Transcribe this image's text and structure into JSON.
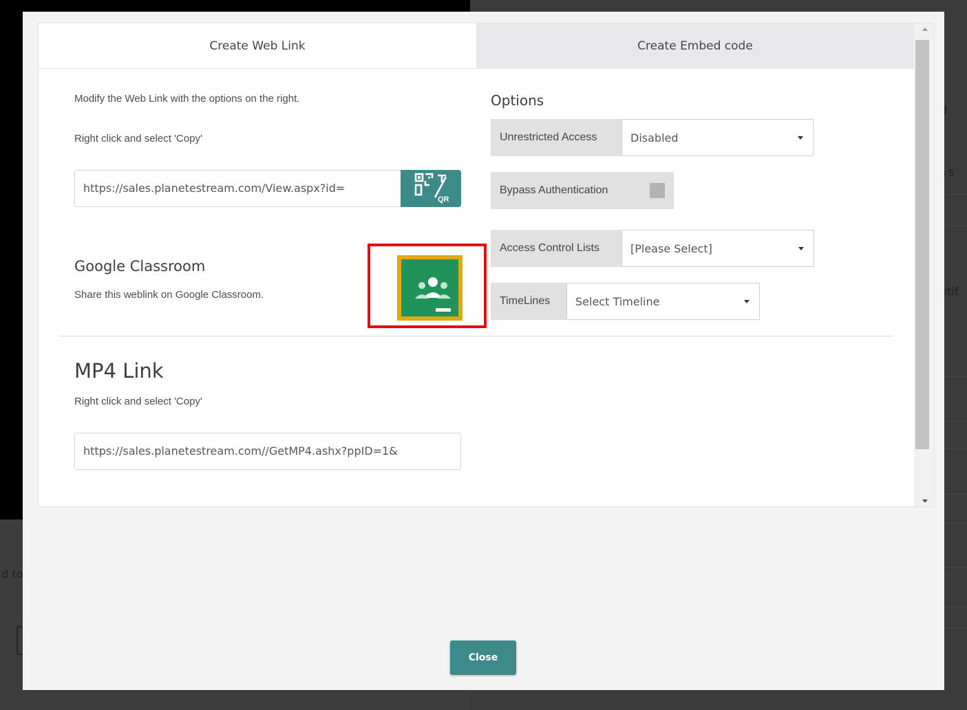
{
  "tabs": [
    {
      "label": "Create Web Link"
    },
    {
      "label": "Create Embed code"
    }
  ],
  "web_link": {
    "instruction": "Modify the Web Link with the options on the right.",
    "copy_hint": "Right click and select 'Copy'",
    "url": "https://sales.planetestream.com/View.aspx?id=",
    "qr_button_icon": "qr-code-icon"
  },
  "google_classroom": {
    "title": "Google Classroom",
    "description": "Share this weblink on Google Classroom.",
    "icon": "google-classroom-icon"
  },
  "mp4": {
    "title": "MP4 Link",
    "copy_hint": "Right click and select 'Copy'",
    "url": "https://sales.planetestream.com//GetMP4.ashx?ppID=1&"
  },
  "options": {
    "title": "Options",
    "unrestricted_access": {
      "label": "Unrestricted Access",
      "value": "Disabled"
    },
    "bypass_authentication": {
      "label": "Bypass Authentication",
      "checked": false
    },
    "access_control_lists": {
      "label": "Access Control Lists",
      "value": "[Please Select]"
    },
    "timelines": {
      "label": "TimeLines",
      "value": "Select Timeline"
    }
  },
  "footer": {
    "close_label": "Close"
  },
  "background": {
    "fragment_left": "d to",
    "fragment_right_1": "g",
    "fragment_right_2": "t",
    "fragment_right_3": "g S",
    "fragment_right_4": "ntif"
  },
  "colors": {
    "accent": "#3d8a8a",
    "highlight": "#e8070e",
    "classroom_green": "#20935a",
    "classroom_frame": "#e0a90f"
  }
}
